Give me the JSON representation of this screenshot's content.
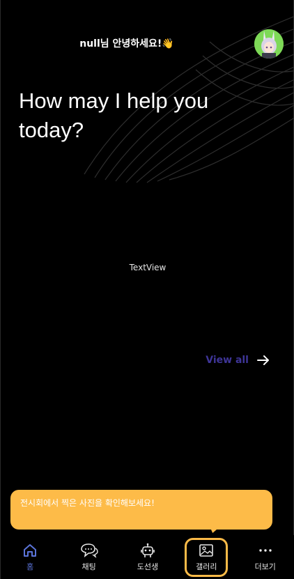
{
  "header": {
    "greeting": "null님 안녕하세요!👋",
    "avatar_icon": "character-avatar-icon"
  },
  "hero": {
    "title": "How may I help you today?"
  },
  "main": {
    "textview": "TextView",
    "view_all_label": "View all",
    "view_all_icon": "arrow-right-icon"
  },
  "tooltip": {
    "message": "전시회에서 찍은 사진을 확인해보세요!"
  },
  "nav": {
    "items": [
      {
        "label": "홈",
        "icon": "home-icon",
        "active": true
      },
      {
        "label": "채팅",
        "icon": "chat-icon",
        "active": false
      },
      {
        "label": "도선생",
        "icon": "robot-icon",
        "active": false
      },
      {
        "label": "갤러리",
        "icon": "gallery-icon",
        "active": false,
        "highlighted": true
      },
      {
        "label": "더보기",
        "icon": "more-icon",
        "active": false
      }
    ]
  },
  "colors": {
    "background": "#000000",
    "accent": "#5b74d9",
    "view_all": "#3e3598",
    "tooltip": "#fdbb48",
    "avatar_bg": "#7ed957"
  }
}
